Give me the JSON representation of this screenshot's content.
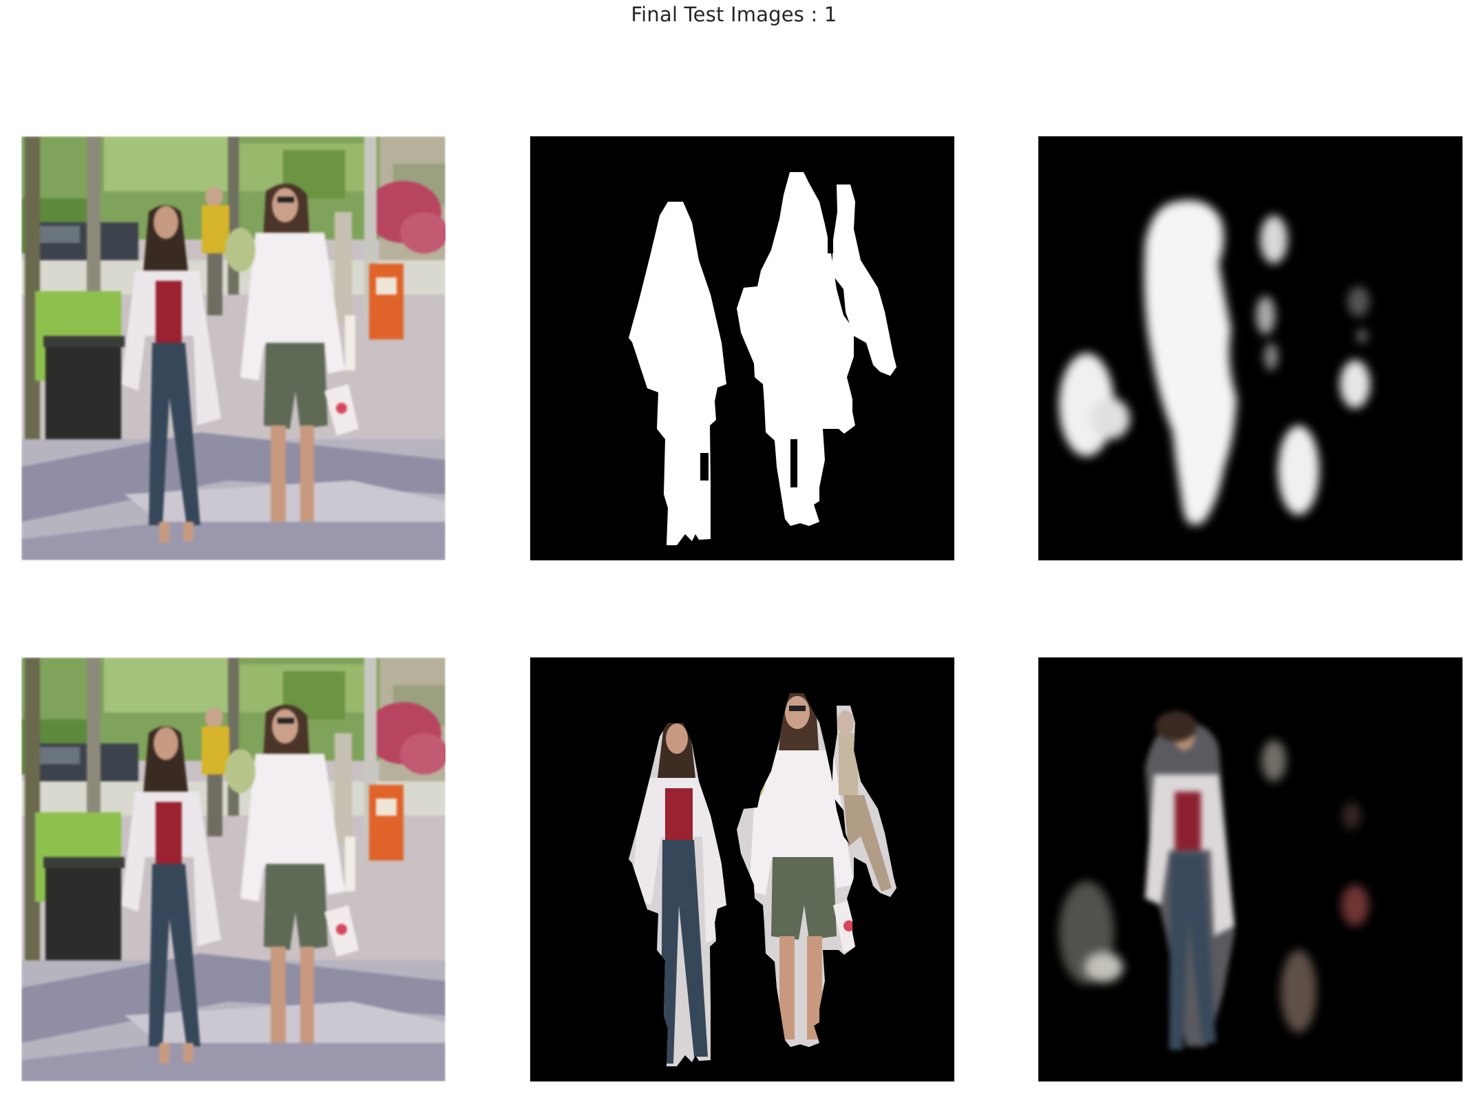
{
  "figure": {
    "title": "Final Test Images : 1"
  },
  "panels": [
    {
      "row": 1,
      "col": 1,
      "content": "input-photo"
    },
    {
      "row": 1,
      "col": 2,
      "content": "ground-truth-mask"
    },
    {
      "row": 1,
      "col": 3,
      "content": "predicted-mask"
    },
    {
      "row": 2,
      "col": 1,
      "content": "input-photo"
    },
    {
      "row": 2,
      "col": 2,
      "content": "ground-truth-masked-photo"
    },
    {
      "row": 2,
      "col": 3,
      "content": "predicted-masked-photo"
    }
  ],
  "colors": {
    "background": "#ffffff",
    "title_text": "#262626",
    "mask_foreground": "#ffffff",
    "mask_background": "#000000"
  }
}
